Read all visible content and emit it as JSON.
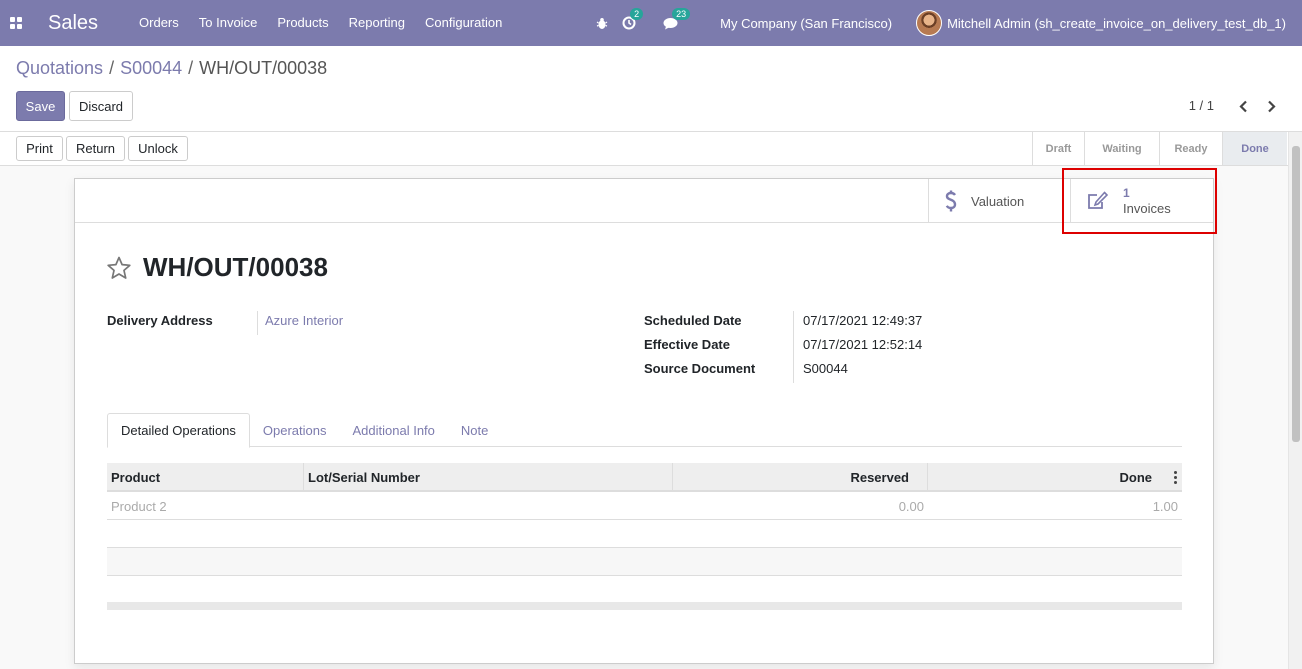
{
  "navbar": {
    "brand": "Sales",
    "menu": [
      "Orders",
      "To Invoice",
      "Products",
      "Reporting",
      "Configuration"
    ],
    "activities_count": "2",
    "messages_count": "23",
    "company": "My Company (San Francisco)",
    "user": "Mitchell Admin (sh_create_invoice_on_delivery_test_db_1)"
  },
  "breadcrumb": {
    "items": [
      "Quotations",
      "S00044"
    ],
    "separator": "/",
    "current": "WH/OUT/00038"
  },
  "actions": {
    "save": "Save",
    "discard": "Discard"
  },
  "pager": {
    "value": "1 / 1"
  },
  "statusbar": {
    "buttons": [
      "Print",
      "Return",
      "Unlock"
    ],
    "stages": [
      "Draft",
      "Waiting",
      "Ready",
      "Done"
    ],
    "current_stage": "Done"
  },
  "smart_buttons": {
    "valuation": "Valuation",
    "invoices_count": "1",
    "invoices_label": "Invoices"
  },
  "record": {
    "title": "WH/OUT/00038",
    "delivery_address_label": "Delivery Address",
    "delivery_address": "Azure Interior",
    "scheduled_date_label": "Scheduled Date",
    "scheduled_date": "07/17/2021 12:49:37",
    "effective_date_label": "Effective Date",
    "effective_date": "07/17/2021 12:52:14",
    "source_document_label": "Source Document",
    "source_document": "S00044"
  },
  "tabs": [
    "Detailed Operations",
    "Operations",
    "Additional Info",
    "Note"
  ],
  "table": {
    "headers": [
      "Product",
      "Lot/Serial Number",
      "Reserved",
      "Done"
    ],
    "rows": [
      {
        "product": "Product 2",
        "lot": "",
        "reserved": "0.00",
        "done": "1.00"
      }
    ]
  },
  "colors": {
    "brand": "#7c7bad",
    "highlight": "#dd0000",
    "badge": "#27a59a"
  }
}
